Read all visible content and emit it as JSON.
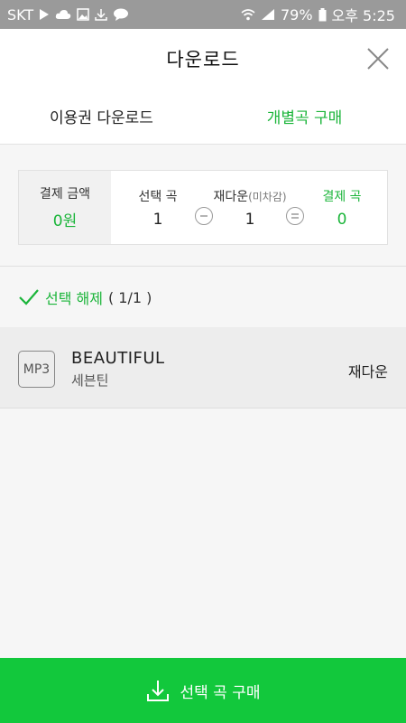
{
  "status_bar": {
    "carrier": "SKT",
    "battery": "79%",
    "time": "오후 5:25"
  },
  "header": {
    "title": "다운로드"
  },
  "tabs": [
    {
      "label": "이용권 다운로드",
      "active": false
    },
    {
      "label": "개별곡 구매",
      "active": true
    }
  ],
  "summary": {
    "amount_label": "결제 금액",
    "amount_value": "0원",
    "selected_label": "선택 곡",
    "selected_value": "1",
    "redownload_label": "재다운",
    "redownload_sub": "(미차감)",
    "redownload_value": "1",
    "pay_label": "결제 곡",
    "pay_value": "0"
  },
  "selection": {
    "label": "선택 해제",
    "count": "( 1/1 )"
  },
  "songs": [
    {
      "format": "MP3",
      "title": "BEAUTIFUL",
      "artist": "세븐틴",
      "status": "재다운"
    }
  ],
  "buy_button": {
    "label": "선택 곡 구매"
  },
  "colors": {
    "accent": "#1bb53a",
    "button": "#12c83c",
    "status_bar": "#9a9a9a"
  }
}
